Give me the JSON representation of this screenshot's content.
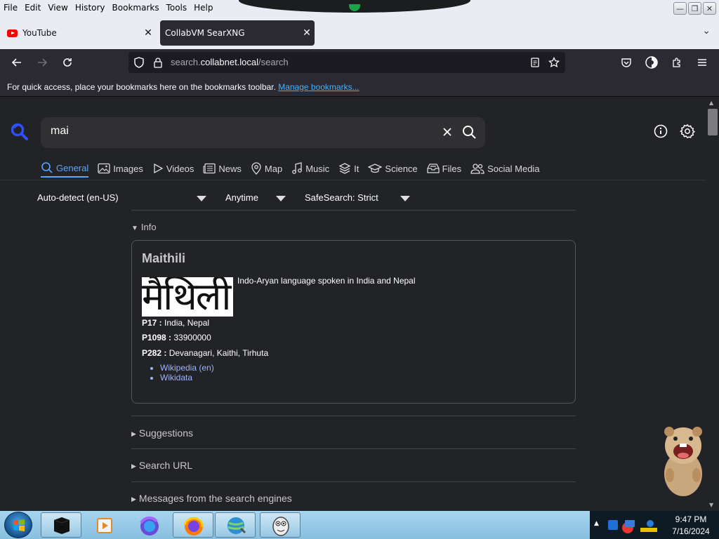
{
  "menubar": {
    "items": [
      "File",
      "Edit",
      "View",
      "History",
      "Bookmarks",
      "Tools",
      "Help"
    ]
  },
  "tabs": [
    {
      "title": "YouTube",
      "icon": "youtube-icon",
      "active": false
    },
    {
      "title": "CollabVM SearXNG",
      "icon": "",
      "active": true
    }
  ],
  "urlbar": {
    "host_prefix": "search.",
    "host": "collabnet.local",
    "path": "/search"
  },
  "bookmarks_bar": {
    "message": "For quick access, place your bookmarks here on the bookmarks toolbar.",
    "link": "Manage bookmarks..."
  },
  "search": {
    "query": "mai"
  },
  "categories": [
    {
      "label": "General",
      "icon": "search-icon",
      "active": true
    },
    {
      "label": "Images",
      "icon": "image-icon"
    },
    {
      "label": "Videos",
      "icon": "play-icon"
    },
    {
      "label": "News",
      "icon": "newspaper-icon"
    },
    {
      "label": "Map",
      "icon": "map-pin-icon"
    },
    {
      "label": "Music",
      "icon": "music-icon"
    },
    {
      "label": "It",
      "icon": "layers-icon"
    },
    {
      "label": "Science",
      "icon": "graduation-cap-icon"
    },
    {
      "label": "Files",
      "icon": "file-drawer-icon"
    },
    {
      "label": "Social Media",
      "icon": "people-icon"
    }
  ],
  "filters": {
    "language": "Auto-detect (en-US)",
    "time_range": "Anytime",
    "safesearch": "SafeSearch: Strict"
  },
  "infobox": {
    "section_label": "Info",
    "title": "Maithili",
    "image_text": "मैथिली",
    "description": "Indo-Aryan language spoken in India and Nepal",
    "attributes": [
      {
        "label": "P17 :",
        "value": "India, Nepal"
      },
      {
        "label": "P1098 :",
        "value": "33900000"
      },
      {
        "label": "P282 :",
        "value": "Devanagari, Kaithi, Tirhuta"
      }
    ],
    "urls": [
      "Wikipedia (en)",
      "Wikidata"
    ]
  },
  "sections": [
    "Suggestions",
    "Search URL",
    "Messages from the search engines"
  ],
  "taskbar": {
    "time": "9:47 PM",
    "date": "7/16/2024"
  },
  "colors": {
    "accent": "#58a6ff",
    "link": "#9db4ff",
    "toolbar": "#2b2a33",
    "page_bg": "#222326"
  }
}
